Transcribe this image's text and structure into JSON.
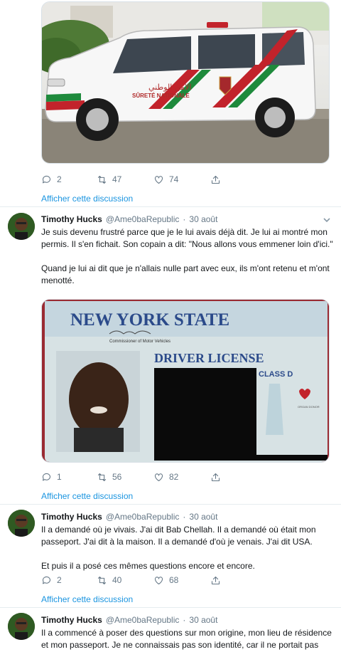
{
  "tweet0": {
    "stats": {
      "replies": "2",
      "retweets": "47",
      "likes": "74"
    },
    "show_thread": "Afficher cette discussion",
    "vehicle": {
      "arabic_text": "الأمن الوطني",
      "french_text": "SÛRETÉ NATIONALE"
    }
  },
  "tweet1": {
    "name": "Timothy Hucks",
    "handle": "@Ame0baRepublic",
    "sep": "·",
    "date": "30 août",
    "para1": "Je suis devenu frustré parce que je le lui avais déjà dit. Je lui ai montré mon permis. Il s'en fichait. Son copain a dit: \"Nous allons vous emmener loin d'ici.\"",
    "para2": "Quand je lui ai dit que je n'allais nulle part avec eux, ils m'ont retenu et m'ont menotté.",
    "license": {
      "state": "NEW YORK STATE",
      "title": "DRIVER LICENSE",
      "class": "CLASS D",
      "commissioner": "Commissioner of Motor Vehicles",
      "donor": "ORGAN DONOR"
    },
    "stats": {
      "replies": "1",
      "retweets": "56",
      "likes": "82"
    },
    "show_thread": "Afficher cette discussion"
  },
  "tweet2": {
    "name": "Timothy Hucks",
    "handle": "@Ame0baRepublic",
    "sep": "·",
    "date": "30 août",
    "para1": "Il a demandé où je vivais. J'ai dit Bab Chellah. Il a demandé où était mon passeport. J'ai dit à la maison. Il a demandé d'où je venais. J'ai dit USA.",
    "para2": "Et puis il a posé ces mêmes questions encore et encore.",
    "stats": {
      "replies": "2",
      "retweets": "40",
      "likes": "68"
    },
    "show_thread": "Afficher cette discussion"
  },
  "tweet3": {
    "name": "Timothy Hucks",
    "handle": "@Ame0baRepublic",
    "sep": "·",
    "date": "30 août",
    "para1": "Il a commencé à poser des questions sur mon origine, mon lieu de résidence et mon passeport. Je ne connaissais pas son identité, car il ne portait pas d'un"
  }
}
